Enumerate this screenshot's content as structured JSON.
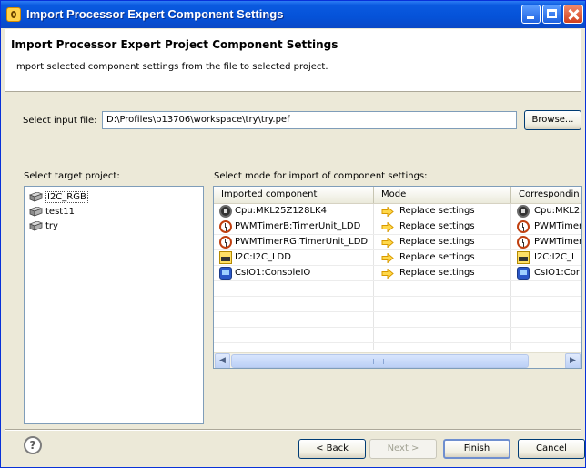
{
  "window": {
    "title": "Import Processor Expert Component Settings"
  },
  "header": {
    "title": "Import Processor Expert Project Component Settings",
    "description": "Import selected component settings from the file to selected project."
  },
  "input_file": {
    "label": "Select input file:",
    "value": "D:\\Profiles\\b13706\\workspace\\try\\try.pef",
    "browse_label": "Browse..."
  },
  "target_project": {
    "label": "Select target project:",
    "items": [
      {
        "label": "I2C_RGB",
        "icon": "project-icon",
        "selected": true
      },
      {
        "label": "test11",
        "icon": "project-icon",
        "selected": false
      },
      {
        "label": "try",
        "icon": "project-icon",
        "selected": false
      }
    ]
  },
  "components": {
    "label": "Select mode for import of component settings:",
    "columns": [
      "Imported component",
      "Mode",
      "Correspondin"
    ],
    "rows": [
      {
        "component": "Cpu:MKL25Z128LK4",
        "icon": "cpu-icon",
        "mode": "Replace settings",
        "corresponding": "Cpu:MKL25"
      },
      {
        "component": "PWMTimerB:TimerUnit_LDD",
        "icon": "timer-icon",
        "mode": "Replace settings",
        "corresponding": "PWMTimer"
      },
      {
        "component": "PWMTimerRG:TimerUnit_LDD",
        "icon": "timer-icon",
        "mode": "Replace settings",
        "corresponding": "PWMTimer"
      },
      {
        "component": "I2C:I2C_LDD",
        "icon": "i2c-icon",
        "mode": "Replace settings",
        "corresponding": "I2C:I2C_L"
      },
      {
        "component": "CsIO1:ConsoleIO",
        "icon": "console-icon",
        "mode": "Replace settings",
        "corresponding": "CsIO1:Cor"
      }
    ]
  },
  "footer": {
    "back_label": "< Back",
    "next_label": "Next >",
    "finish_label": "Finish",
    "cancel_label": "Cancel"
  },
  "colors": {
    "titlebar": "#0552d8",
    "dialog_bg": "#ece9d8",
    "mode_arrow": "#f5b800"
  }
}
